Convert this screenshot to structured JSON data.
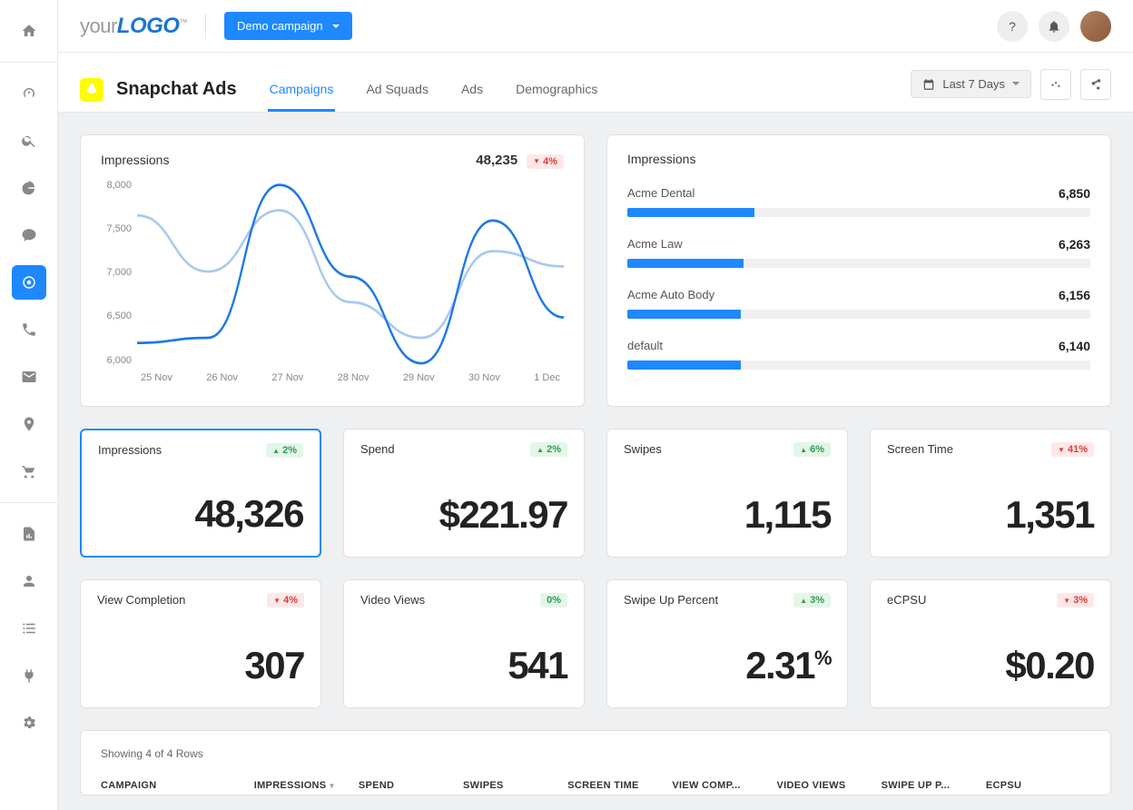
{
  "header": {
    "logo_prefix": "your",
    "logo_bold": "LOGO",
    "logo_tm": "™",
    "campaign_btn": "Demo campaign",
    "date_range": "Last 7 Days"
  },
  "page": {
    "title": "Snapchat Ads",
    "tabs": [
      {
        "label": "Campaigns",
        "active": true
      },
      {
        "label": "Ad Squads",
        "active": false
      },
      {
        "label": "Ads",
        "active": false
      },
      {
        "label": "Demographics",
        "active": false
      }
    ]
  },
  "chart": {
    "title": "Impressions",
    "total": "48,235",
    "delta": {
      "dir": "down",
      "text": "4%"
    }
  },
  "chart_data": {
    "type": "line",
    "xlabel": "",
    "ylabel": "",
    "ylim": [
      6000,
      8000
    ],
    "categories": [
      "25 Nov",
      "26 Nov",
      "27 Nov",
      "28 Nov",
      "29 Nov",
      "30 Nov",
      "1 Dec"
    ],
    "series": [
      {
        "name": "current",
        "values": [
          6400,
          6450,
          7950,
          7050,
          6200,
          7600,
          6650
        ],
        "color": "#1e78e6"
      },
      {
        "name": "previous",
        "values": [
          7650,
          7100,
          7700,
          6800,
          6450,
          7300,
          7150
        ],
        "color": "#a8c8f2"
      }
    ],
    "y_ticks": [
      "8,000",
      "7,500",
      "7,000",
      "6,500",
      "6,000"
    ]
  },
  "bars": {
    "title": "Impressions",
    "max": 25000,
    "items": [
      {
        "label": "Acme Dental",
        "value": "6,850",
        "num": 6850
      },
      {
        "label": "Acme Law",
        "value": "6,263",
        "num": 6263
      },
      {
        "label": "Acme Auto Body",
        "value": "6,156",
        "num": 6156
      },
      {
        "label": "default",
        "value": "6,140",
        "num": 6140
      }
    ]
  },
  "metrics": [
    {
      "label": "Impressions",
      "value": "48,326",
      "delta": {
        "dir": "up",
        "text": "2%"
      },
      "selected": true
    },
    {
      "label": "Spend",
      "value": "$221.97",
      "delta": {
        "dir": "up",
        "text": "2%"
      }
    },
    {
      "label": "Swipes",
      "value": "1,115",
      "delta": {
        "dir": "up",
        "text": "6%"
      }
    },
    {
      "label": "Screen Time",
      "value": "1,351",
      "delta": {
        "dir": "down",
        "text": "41%"
      }
    },
    {
      "label": "View Completion",
      "value": "307",
      "delta": {
        "dir": "down",
        "text": "4%"
      }
    },
    {
      "label": "Video Views",
      "value": "541",
      "delta": {
        "dir": "neutral",
        "text": "0%"
      }
    },
    {
      "label": "Swipe Up Percent",
      "value": "2.31",
      "unit": "%",
      "delta": {
        "dir": "up",
        "text": "3%"
      }
    },
    {
      "label": "eCPSU",
      "value": "$0.20",
      "delta": {
        "dir": "down",
        "text": "3%"
      }
    }
  ],
  "table": {
    "info": "Showing 4 of 4 Rows",
    "columns": [
      "CAMPAIGN",
      "IMPRESSIONS",
      "SPEND",
      "SWIPES",
      "SCREEN TIME",
      "VIEW COMP...",
      "VIDEO VIEWS",
      "SWIPE UP P...",
      "ECPSU"
    ],
    "sort_col_index": 1
  }
}
